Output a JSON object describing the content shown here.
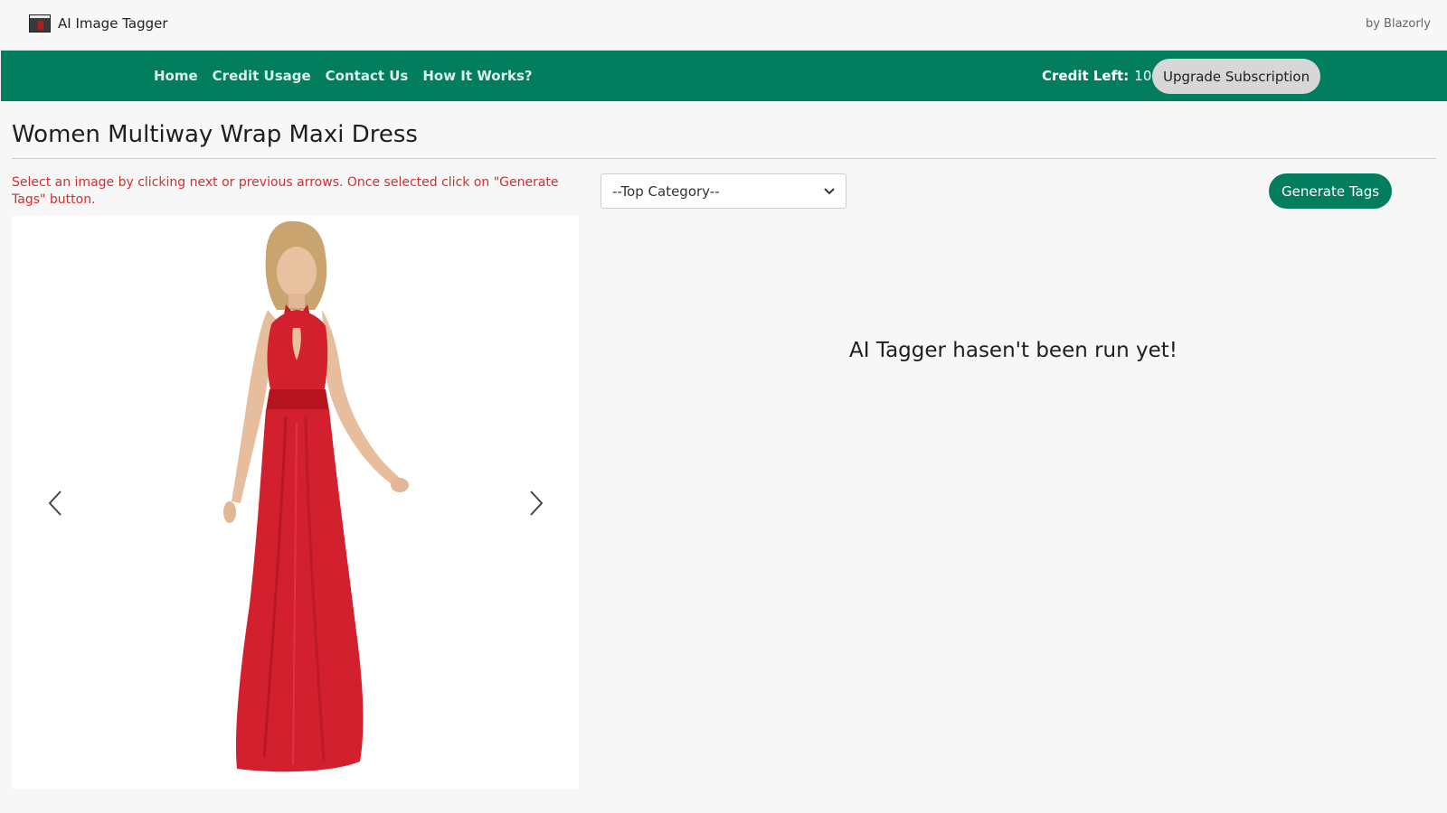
{
  "header": {
    "app_name": "AI Image Tagger",
    "logo_icon": "app-logo-icon",
    "by_line": "by Blazorly"
  },
  "nav": {
    "links": [
      "Home",
      "Credit Usage",
      "Contact Us",
      "How It Works?"
    ],
    "credit_label": "Credit Left:",
    "credit_value": "100",
    "upgrade_label": "Upgrade Subscription"
  },
  "page": {
    "title": "Women Multiway Wrap Maxi Dress",
    "instruction": "Select an image by clicking next or previous arrows. Once selected click on \"Generate Tags\" button."
  },
  "carousel": {
    "image_subject": "red-halter-maxi-dress-model",
    "prev_icon": "chevron-left-icon",
    "next_icon": "chevron-right-icon"
  },
  "controls": {
    "category_selected": "--Top Category--",
    "generate_label": "Generate Tags"
  },
  "results": {
    "empty_message": "AI Tagger hasen't been run yet!"
  },
  "colors": {
    "brand_green": "#027d5e",
    "instruction_red": "#d32f2f",
    "dress_red": "#d3202e",
    "background": "#f7f7f7"
  }
}
